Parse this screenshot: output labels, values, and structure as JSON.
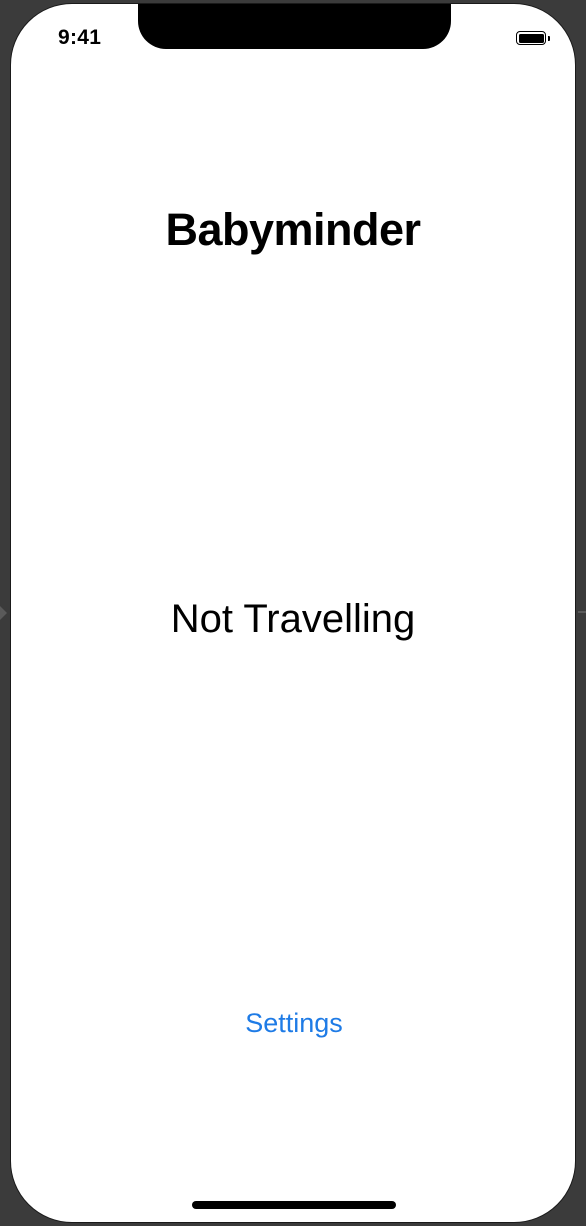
{
  "status_bar": {
    "time": "9:41",
    "battery_icon": "battery-full-icon"
  },
  "app": {
    "title": "Babyminder",
    "travel_status": "Not Travelling",
    "settings_label": "Settings"
  },
  "colors": {
    "accent": "#1e7be6",
    "background": "#ffffff",
    "frame": "#3b3b3b"
  }
}
